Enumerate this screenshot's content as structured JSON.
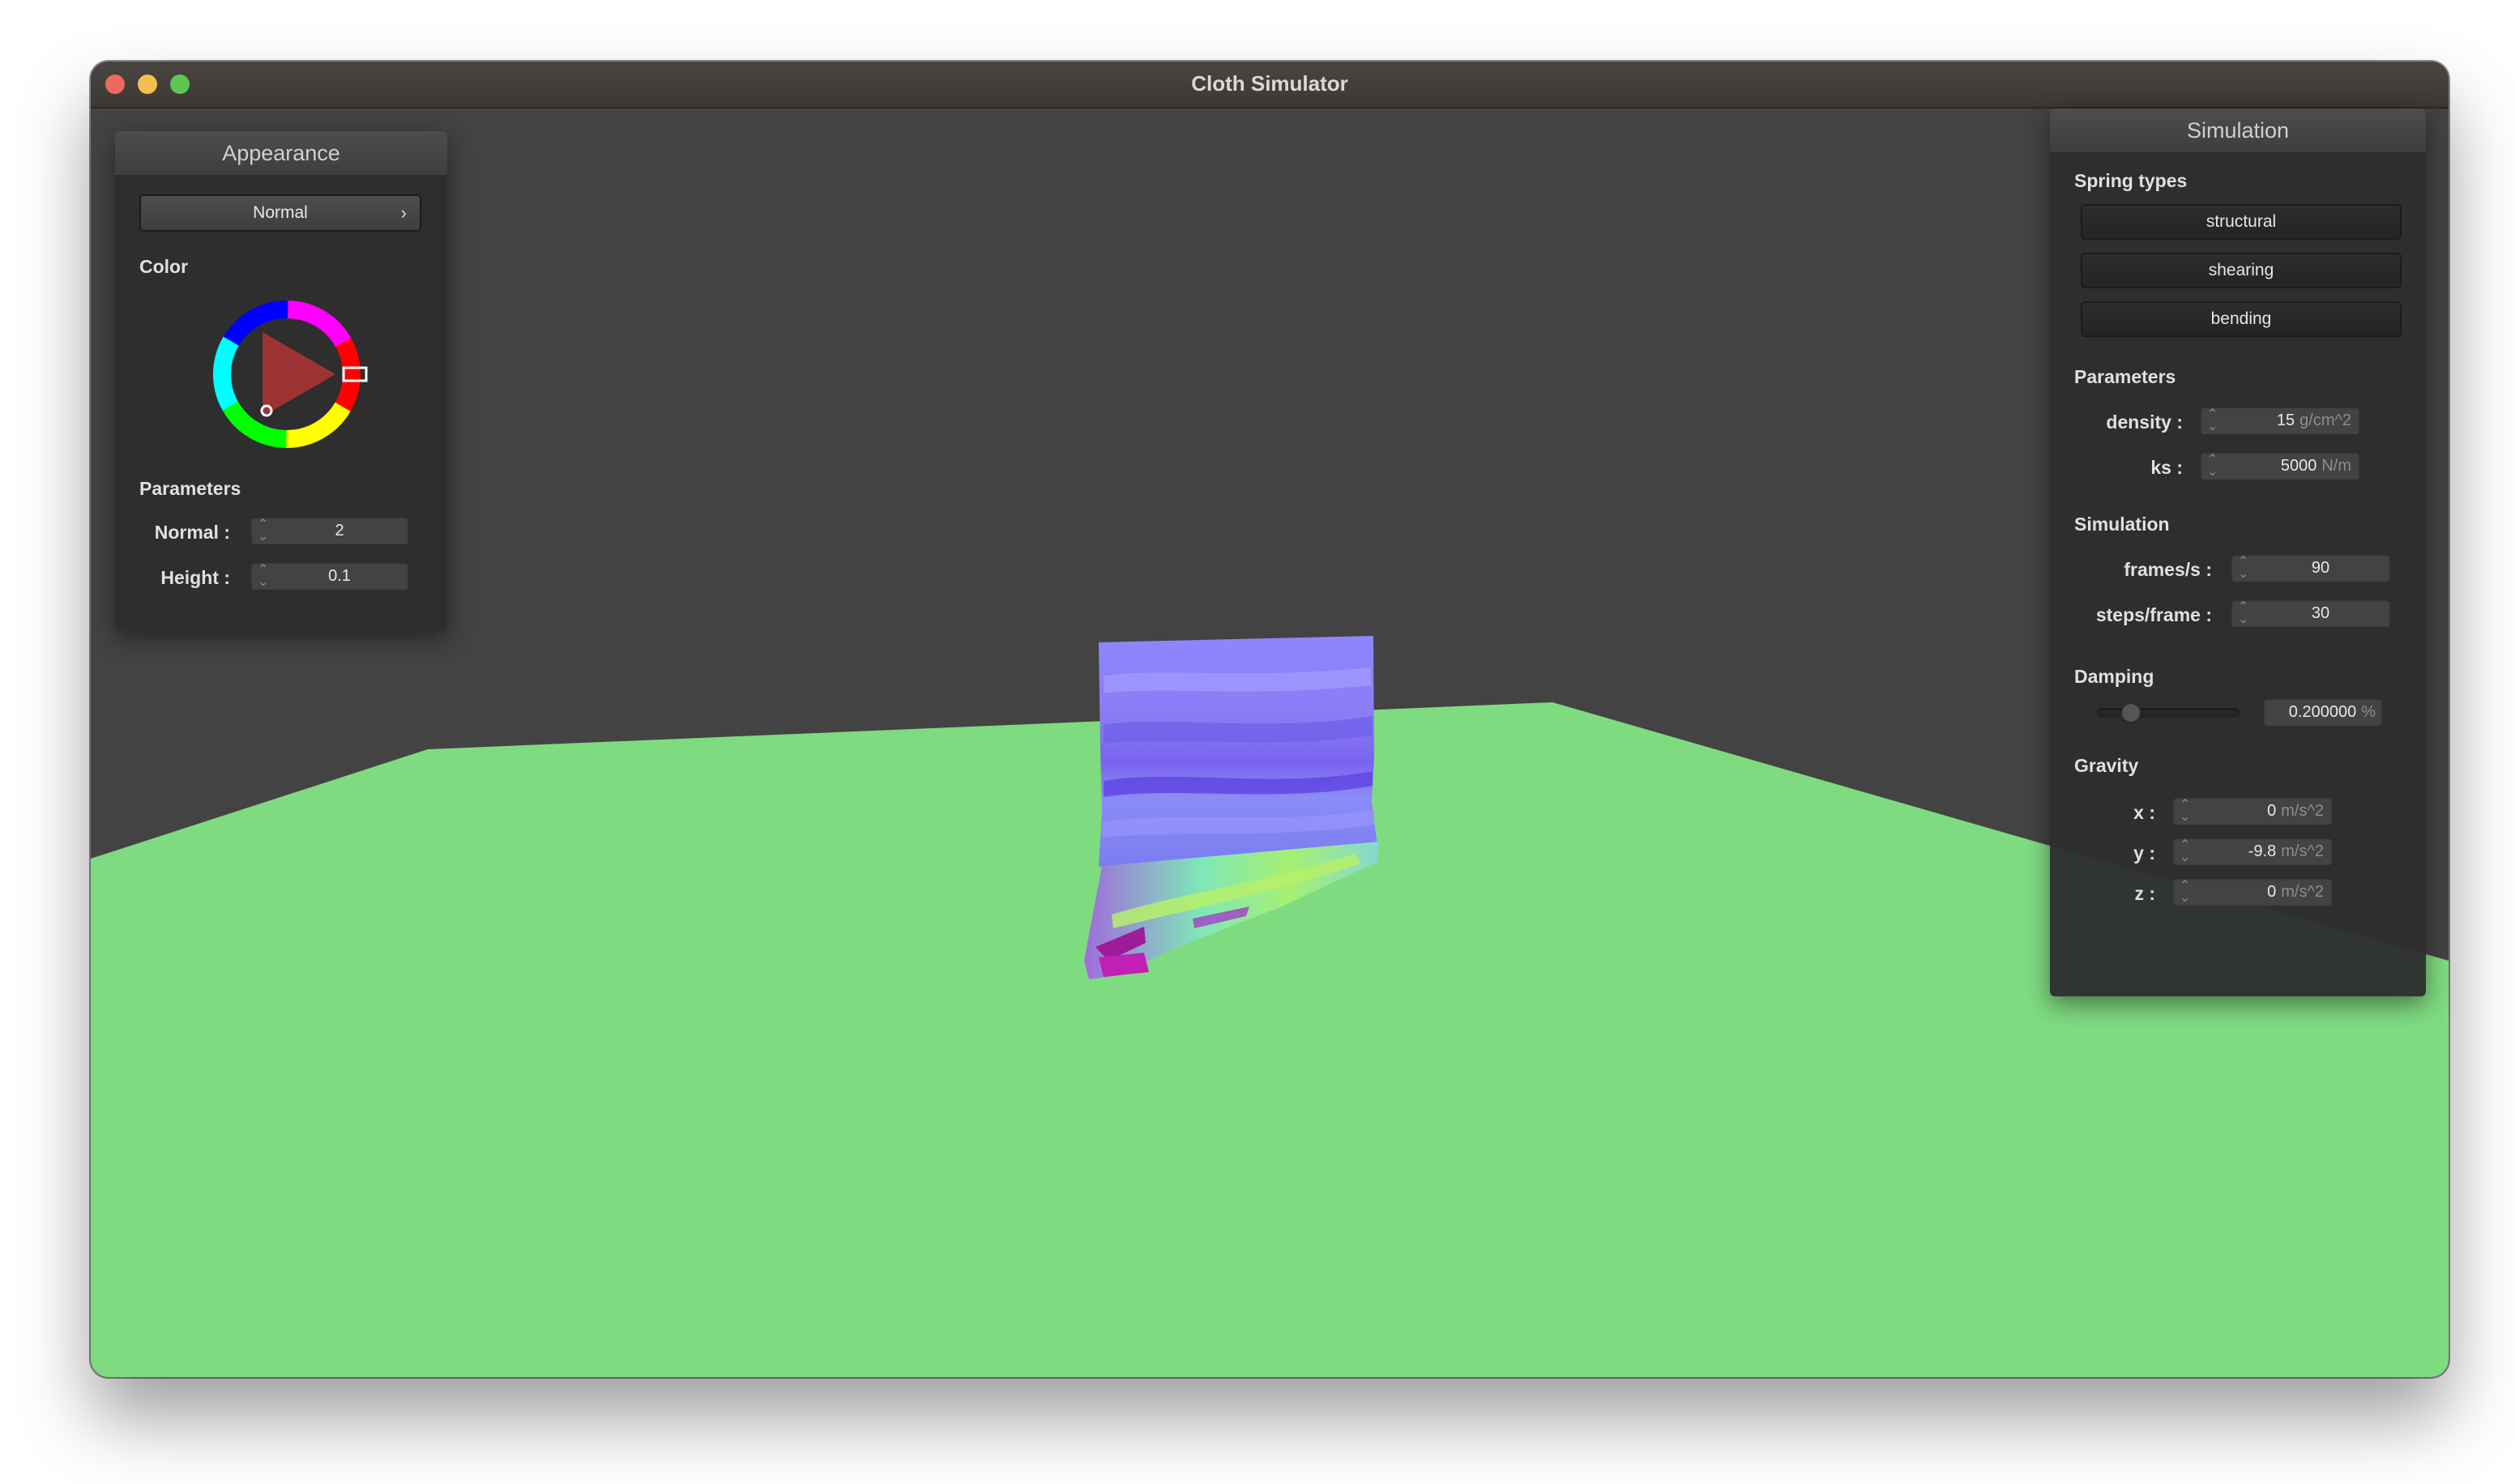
{
  "window": {
    "title": "Cloth Simulator"
  },
  "appearance": {
    "title": "Appearance",
    "shader": "Normal",
    "color_label": "Color",
    "parameters_label": "Parameters",
    "normal_label": "Normal :",
    "normal_value": "2",
    "height_label": "Height :",
    "height_value": "0.1",
    "selected_color": "#ff2020"
  },
  "simulation_panel": {
    "title": "Simulation",
    "spring_types_label": "Spring types",
    "springs": [
      "structural",
      "shearing",
      "bending"
    ],
    "parameters_label": "Parameters",
    "density_label": "density :",
    "density_value": "15",
    "density_unit": "g/cm^2",
    "ks_label": "ks :",
    "ks_value": "5000",
    "ks_unit": "N/m",
    "simulation_label": "Simulation",
    "fps_label": "frames/s :",
    "fps_value": "90",
    "steps_label": "steps/frame :",
    "steps_value": "30",
    "damping_label": "Damping",
    "damping_value": "0.200000",
    "damping_unit": "%",
    "damping_fraction": 0.2,
    "gravity_label": "Gravity",
    "gx_label": "x :",
    "gx_value": "0",
    "gy_label": "y :",
    "gy_value": "-9.8",
    "gz_label": "z :",
    "gz_value": "0",
    "gravity_unit": "m/s^2"
  },
  "scene": {
    "background": "#434343",
    "floor_color": "#7fdb80"
  }
}
